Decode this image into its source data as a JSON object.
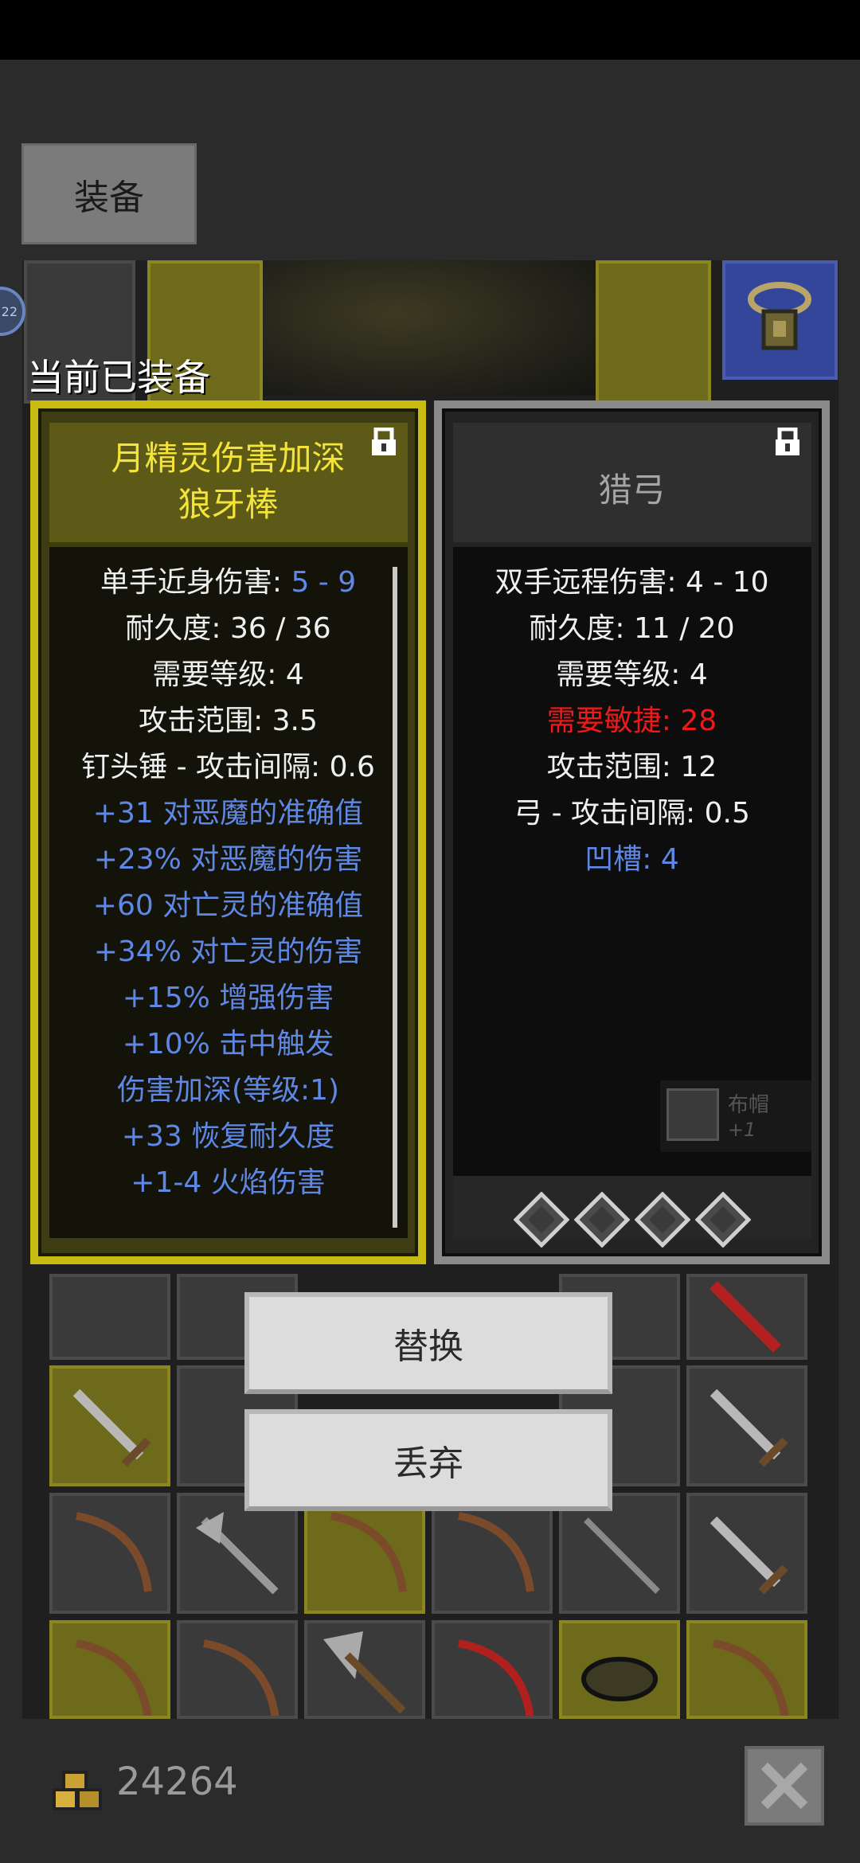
{
  "tabs": {
    "equipment": "装备"
  },
  "current_equipped_label": "当前已装备",
  "level_badge": "22",
  "left_card": {
    "title_lines": [
      "月精灵伤害加深",
      "狼牙棒"
    ],
    "stats": [
      {
        "label": "单手近身伤害: ",
        "value": "5 - 9",
        "style": "mixed"
      },
      {
        "text": "耐久度: 36 / 36",
        "style": "white"
      },
      {
        "text": "需要等级: 4",
        "style": "white"
      },
      {
        "text": "攻击范围: 3.5",
        "style": "white"
      },
      {
        "text": "钉头锤 - 攻击间隔: 0.6",
        "style": "white"
      },
      {
        "text": "+31 对恶魔的准确值",
        "style": "blue"
      },
      {
        "text": "+23% 对恶魔的伤害",
        "style": "blue"
      },
      {
        "text": "+60 对亡灵的准确值",
        "style": "blue"
      },
      {
        "text": "+34% 对亡灵的伤害",
        "style": "blue"
      },
      {
        "text": "+15% 增强伤害",
        "style": "blue"
      },
      {
        "text": "+10% 击中触发",
        "style": "blue"
      },
      {
        "text": "伤害加深(等级:1)",
        "style": "blue"
      },
      {
        "text": "+33 恢复耐久度",
        "style": "blue"
      },
      {
        "text": "+1-4 火焰伤害",
        "style": "blue"
      }
    ],
    "locked": true
  },
  "right_card": {
    "title": "猎弓",
    "stats": [
      {
        "text": "双手远程伤害: 4 - 10",
        "style": "white"
      },
      {
        "text": "耐久度: 11 / 20",
        "style": "white"
      },
      {
        "text": "需要等级: 4",
        "style": "white"
      },
      {
        "text": "需要敏捷: 28",
        "style": "red"
      },
      {
        "text": "攻击范围: 12",
        "style": "white"
      },
      {
        "text": "弓 - 攻击间隔: 0.5",
        "style": "white"
      },
      {
        "text": "凹槽: 4",
        "style": "blue"
      }
    ],
    "sockets": 4,
    "locked": true,
    "mini_tooltip": {
      "name": "布帽",
      "plus": "+1"
    }
  },
  "buttons": {
    "replace": "替换",
    "discard": "丢弃"
  },
  "gold": {
    "amount": "24264"
  },
  "colors": {
    "gold_card": "#c8bc12",
    "magic_blue": "#5f88e6",
    "requirement_red": "#f01818"
  }
}
